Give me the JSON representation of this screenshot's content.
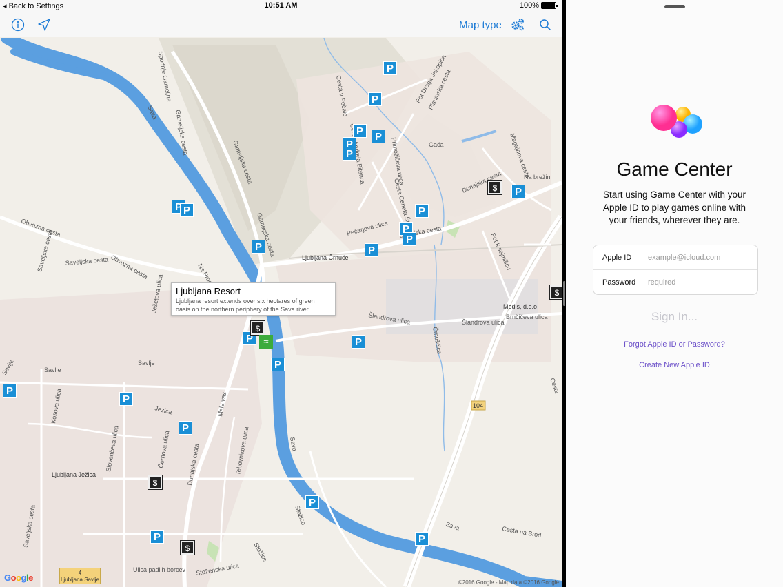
{
  "status_bar": {
    "back_label": "Back to Settings",
    "time": "10:51 AM",
    "battery": "100%"
  },
  "toolbar": {
    "map_type_label": "Map type",
    "info_icon": "info-icon",
    "locate_icon": "location-arrow-icon",
    "settings_icon": "gears-icon",
    "search_icon": "search-icon"
  },
  "map": {
    "street_labels": [
      "Spodnje Gameljne",
      "Gameljska cesta",
      "Gameljska cesta",
      "Gameljska cesta",
      "Sava",
      "Sava",
      "Sava",
      "Obvozna cesta",
      "Obvozna cesta",
      "Saveljska cesta",
      "Saveljska cesta",
      "Saveljska cesta",
      "Savlje",
      "Savlje",
      "Savlje",
      "Ješetova ulica",
      "Jezica",
      "Černova ulica",
      "Dunajska cesta",
      "Dunajska cesta",
      "Dunajska cesta",
      "Slovenčeva ulica",
      "Kosova ulica",
      "Tebovnikova ulica",
      "Mala vas",
      "Cesta v Pečale",
      "Cesta Andreja Bitenca",
      "Primožičeva ulica",
      "Cesta Ceneta Štuparja",
      "Pečarjeva ulica",
      "Pot Draga Jakopiča",
      "Planinska cesta",
      "Gača",
      "Na brežini",
      "Šlandrova ulica",
      "Šlandrova ulica",
      "Brnčičeva ulica",
      "Črnuščica",
      "Pot k sejmišču",
      "Cesta na Brod",
      "Ulica padlih borcev",
      "Stožice",
      "Stožice",
      "Stoženska ulica",
      "Na Produ",
      "Medis, d.o.o",
      "Magajnova cesta",
      "Cesta",
      "Ljubljana Črnuče",
      "Ljubljana Ježica",
      "Ljubljana Savlje",
      "104"
    ],
    "callout": {
      "title": "Ljubljana Resort",
      "description": "Ljubljana resort extends over six hectares of green oasis on the northern periphery of the Sava river."
    },
    "parking_symbol": "P",
    "atm_symbol": "$",
    "google_logo": "Google",
    "credit": "©2016 Google - Map data ©2016 Google",
    "station_badge": "4",
    "colors": {
      "river": "#5b9fe0",
      "parking": "#1a8fd6",
      "highway": "#ffffff",
      "land": "#f2efe9",
      "hills": "#e2dfd6"
    }
  },
  "game_center": {
    "title": "Game Center",
    "subtitle": "Start using Game Center with your Apple ID to play games online with your friends, wherever they are.",
    "apple_id_label": "Apple ID",
    "apple_id_placeholder": "example@icloud.com",
    "password_label": "Password",
    "password_placeholder": "required",
    "sign_in_label": "Sign In...",
    "forgot_label": "Forgot Apple ID or Password?",
    "create_label": "Create New Apple ID",
    "colors": {
      "link": "#6b4fc9",
      "disabled": "#c5c5cc"
    }
  }
}
